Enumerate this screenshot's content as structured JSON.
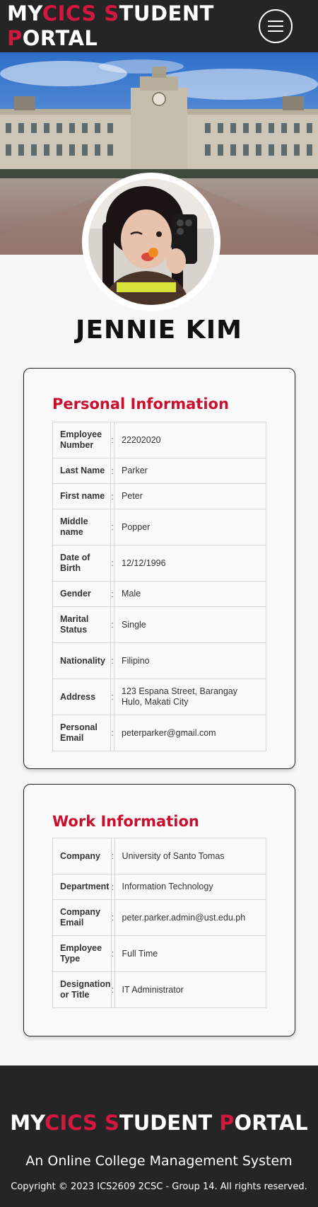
{
  "header": {
    "brand": {
      "line1": [
        {
          "t": "MY",
          "red": false
        },
        {
          "t": "CICS",
          "red": true
        },
        {
          "t": " ",
          "red": false
        },
        {
          "t": "S",
          "red": true
        },
        {
          "t": "TUDENT",
          "red": false
        }
      ],
      "line2": [
        {
          "t": "P",
          "red": true
        },
        {
          "t": "ORTAL",
          "red": false
        }
      ]
    },
    "menu_icon": "hamburger-menu-icon"
  },
  "colors": {
    "accent": "#d4173f",
    "header_bg": "#252525",
    "page_bg": "#f7f7f7"
  },
  "profile": {
    "name": "JENNIE KIM"
  },
  "personal": {
    "title": "Personal Information",
    "rows": [
      {
        "label": "Employee Number",
        "value": "22202020"
      },
      {
        "label": "Last Name",
        "value": "Parker"
      },
      {
        "label": "First name",
        "value": "Peter"
      },
      {
        "label": "Middle name",
        "value": "Popper"
      },
      {
        "label": "Date of Birth",
        "value": "12/12/1996"
      },
      {
        "label": "Gender",
        "value": "Male"
      },
      {
        "label": "Marital Status",
        "value": "Single"
      },
      {
        "label": "Nationality",
        "value": "Filipino"
      },
      {
        "label": "Address",
        "value": "123 Espana Street, Barangay Hulo, Makati City"
      },
      {
        "label": "Personal Email",
        "value": "peterparker@gmail.com"
      }
    ]
  },
  "work": {
    "title": "Work Information",
    "rows": [
      {
        "label": "Company",
        "value": "University of Santo Tomas"
      },
      {
        "label": "Department",
        "value": "Information Technology"
      },
      {
        "label": "Company Email",
        "value": "peter.parker.admin@ust.edu.ph"
      },
      {
        "label": "Employee Type",
        "value": "Full Time"
      },
      {
        "label": "Designation or Title",
        "value": "IT Administrator"
      }
    ]
  },
  "footer": {
    "brand": [
      {
        "t": "MY",
        "red": false
      },
      {
        "t": "CICS",
        "red": true
      },
      {
        "t": " ",
        "red": false
      },
      {
        "t": "S",
        "red": true
      },
      {
        "t": "TUDENT ",
        "red": false
      },
      {
        "t": "P",
        "red": true
      },
      {
        "t": "ORTAL",
        "red": false
      }
    ],
    "tagline": "An Online College Management System",
    "copyright": "Copyright © 2023 ICS2609 2CSC - Group 14. All rights reserved."
  }
}
